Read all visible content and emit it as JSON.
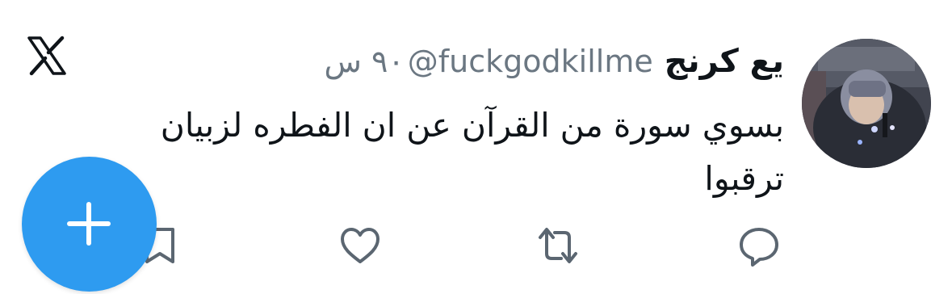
{
  "tweet": {
    "display_name": "يع كرنج",
    "handle": "@fuckgodkillme",
    "timestamp": "٩٠ س",
    "text_line_1": "بسوي سورة من القرآن عن ان الفطره لزبيان",
    "text_line_2": "ترقبوا"
  },
  "icons": {
    "platform": "x-logo-icon",
    "reply": "reply-icon",
    "retweet": "retweet-icon",
    "like": "heart-icon",
    "bookmark": "bookmark-icon",
    "compose": "plus-icon"
  },
  "colors": {
    "accent": "#2e9bf0",
    "text": "#0f1419",
    "secondary_text": "#6b7782"
  }
}
